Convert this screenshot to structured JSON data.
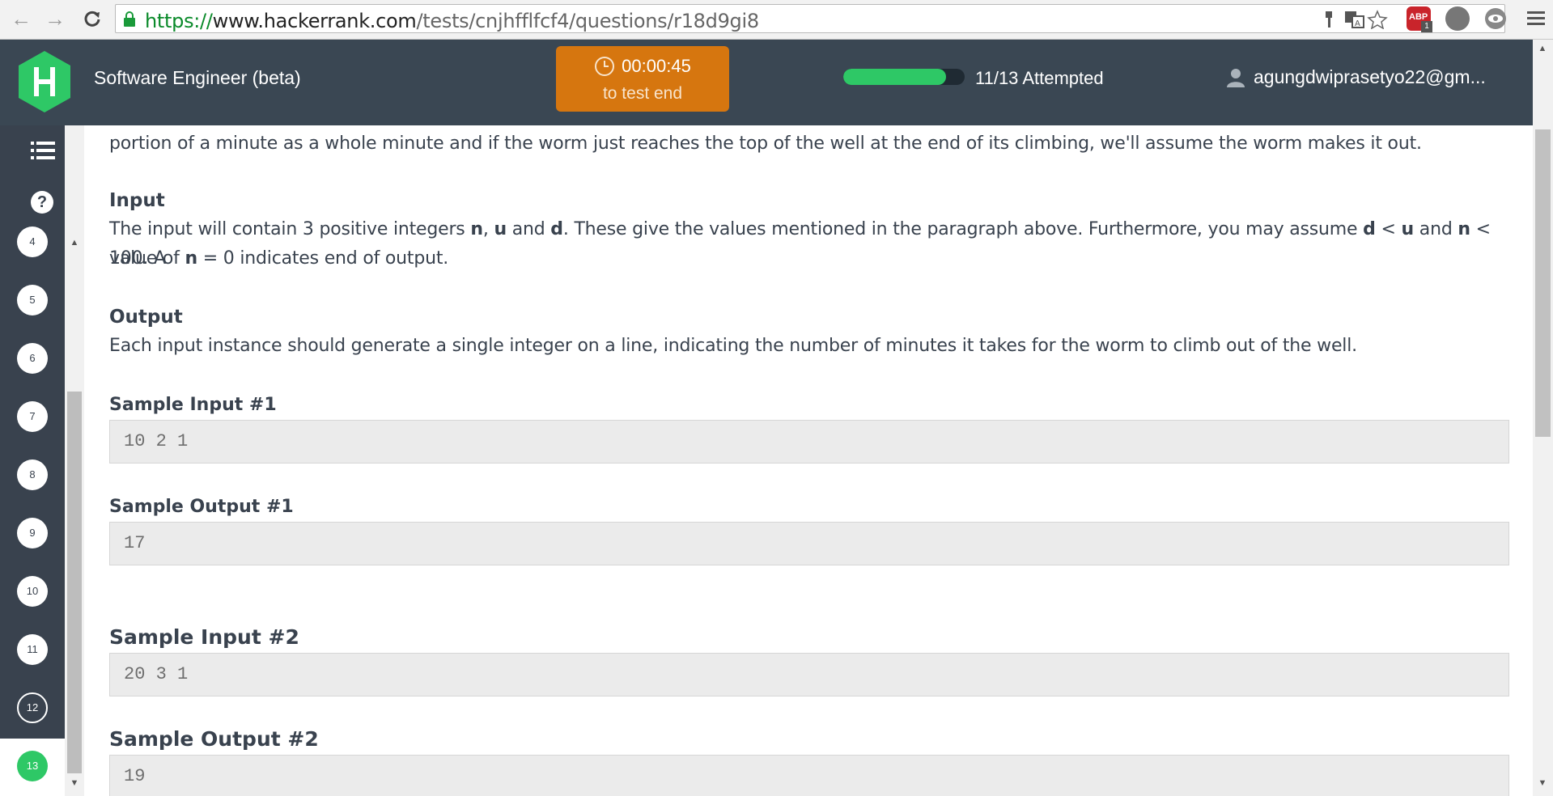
{
  "browser": {
    "url_protocol": "https://",
    "url_host": "www.hackerrank.com",
    "url_path": "/tests/cnjhfflfcf4/questions/r18d9gi8",
    "icons": [
      "back-arrow-icon",
      "forward-arrow-icon",
      "reload-icon",
      "lock-icon",
      "key-icon",
      "translate-icon",
      "star-icon",
      "adblock-plus-icon",
      "extension-icon",
      "eye-icon",
      "menu-icon"
    ],
    "adblock_label": "ABP",
    "adblock_count": "1"
  },
  "header": {
    "title": "Software Engineer (beta)",
    "timer": "00:00:45",
    "timer_sub": "to test end",
    "progress_fraction": 0.846,
    "attempted": "11/13 Attempted",
    "user_email": "agungdwiprasetyo22@gm...",
    "accent_color": "#d6760f",
    "progress_color": "#2ec866"
  },
  "sidebar": {
    "questions": [
      "4",
      "5",
      "6",
      "7",
      "8",
      "9",
      "10",
      "11",
      "12",
      "13"
    ],
    "current_question": "13",
    "help_glyph": "?"
  },
  "content": {
    "intro_line": "portion of a minute as a whole minute and if the worm just reaches the top of the well at the end of its climbing, we'll assume the worm makes it out.",
    "input_heading": "Input",
    "input_line1": "The input will contain 3 positive integers n, u and d. These give the values mentioned in the paragraph above. Furthermore, you may assume d < u and n < 100. A",
    "input_line2": "value of n = 0 indicates end of output.",
    "output_heading": "Output",
    "output_line": "Each input instance should generate a single integer on a line, indicating the number of minutes it takes for the worm to climb out of the well.",
    "sample_input_1_heading": "Sample Input #1",
    "sample_input_1": "10 2 1",
    "sample_output_1_heading": "Sample Output #1",
    "sample_output_1": "17",
    "sample_input_2_heading": "Sample Input #2",
    "sample_input_2": "20 3 1",
    "sample_output_2_heading": "Sample Output #2",
    "sample_output_2": "19"
  }
}
